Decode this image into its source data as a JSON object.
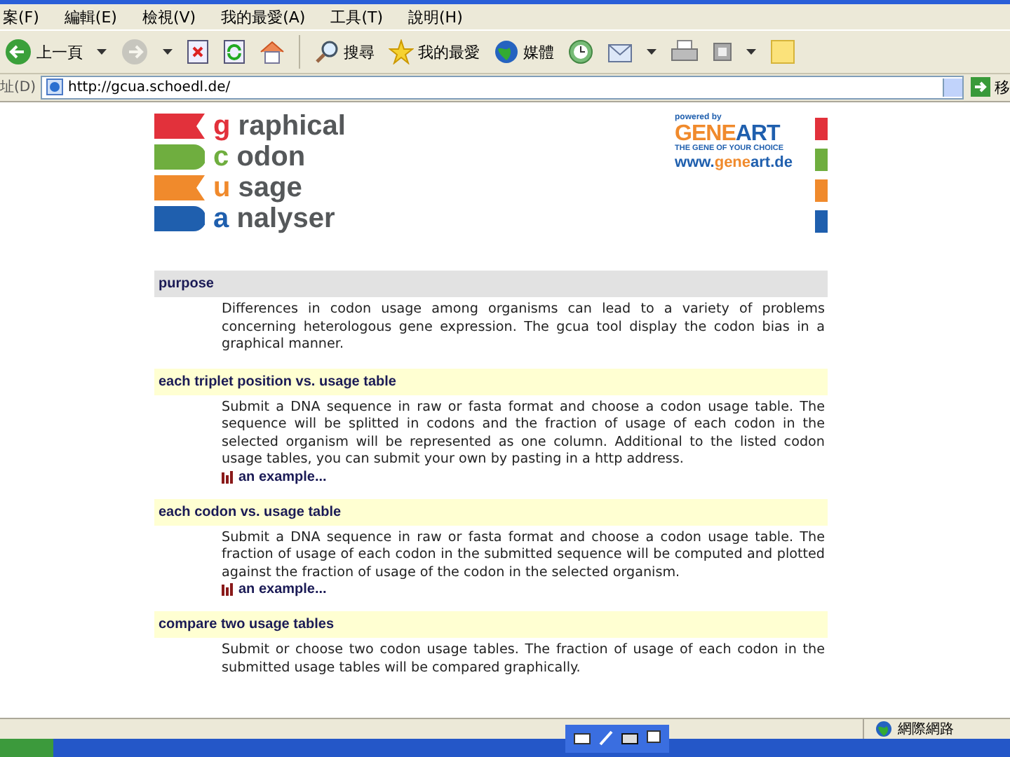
{
  "menu_bar": {
    "items": [
      "案(F)",
      "編輯(E)",
      "檢視(V)",
      "我的最愛(A)",
      "工具(T)",
      "說明(H)"
    ]
  },
  "toolbar": {
    "buttons": [
      {
        "kind": "back",
        "label": "上一頁",
        "dropdown": true,
        "disabled": false
      },
      {
        "kind": "forward",
        "dropdown": true,
        "disabled": true
      },
      {
        "kind": "stop"
      },
      {
        "kind": "refresh"
      },
      {
        "kind": "home"
      },
      {
        "kind": "separator"
      },
      {
        "kind": "search",
        "label": "搜尋"
      },
      {
        "kind": "favorites",
        "label": "我的最愛"
      },
      {
        "kind": "media",
        "label": "媒體"
      },
      {
        "kind": "history"
      },
      {
        "kind": "mail",
        "dropdown": true
      },
      {
        "kind": "print"
      },
      {
        "kind": "edit",
        "dropdown": true
      },
      {
        "kind": "note"
      }
    ]
  },
  "address_bar": {
    "label": "址(D)",
    "value": "http://gcua.schoedl.de/",
    "go": "移"
  },
  "logo": {
    "rows": [
      {
        "kind": "notch",
        "color": "#e2313b",
        "initial": "g",
        "rest": "raphical"
      },
      {
        "kind": "round",
        "color": "#6fae3f",
        "initial": "c",
        "rest": "odon"
      },
      {
        "kind": "notch",
        "color": "#f08a2c",
        "initial": "u",
        "rest": "sage"
      },
      {
        "kind": "round",
        "color": "#1f5fae",
        "initial": "a",
        "rest": "nalyser"
      }
    ]
  },
  "sponsor": {
    "powered_by": "powered by",
    "wordmark": [
      "GENE",
      "ART"
    ],
    "slogan": "THE GENE OF YOUR CHOICE",
    "url": [
      "www.",
      "gene",
      "art.de"
    ]
  },
  "sections": [
    {
      "kind": "intro",
      "title": "purpose",
      "text": "Differences in codon usage among organisms can lead to a variety of problems concerning heterologous gene expression. The gcua tool display the codon bias in a graphical manner."
    },
    {
      "kind": "task",
      "title": "each triplet position vs. usage table",
      "text": "Submit a DNA sequence in raw or fasta format and choose a codon usage table. The sequence will be splitted in codons and the fraction of usage of each codon in the selected organism will be represented as one column. Additional to the listed codon usage tables, you can submit your own by pasting in a http address.",
      "link": "an example..."
    },
    {
      "kind": "task",
      "title": "each codon vs. usage table",
      "text": "Submit a DNA sequence in raw or fasta format and choose a codon usage table. The fraction of usage of each codon in the submitted sequence will be computed and plotted against the fraction of usage of the codon in the selected organism.",
      "link": "an example..."
    },
    {
      "kind": "task",
      "title": "compare two usage tables",
      "text": "Submit or choose two codon usage tables. The fraction of usage of each codon in the submitted usage tables will be compared graphically."
    }
  ],
  "status_bar": {
    "zone": "網際網路"
  }
}
